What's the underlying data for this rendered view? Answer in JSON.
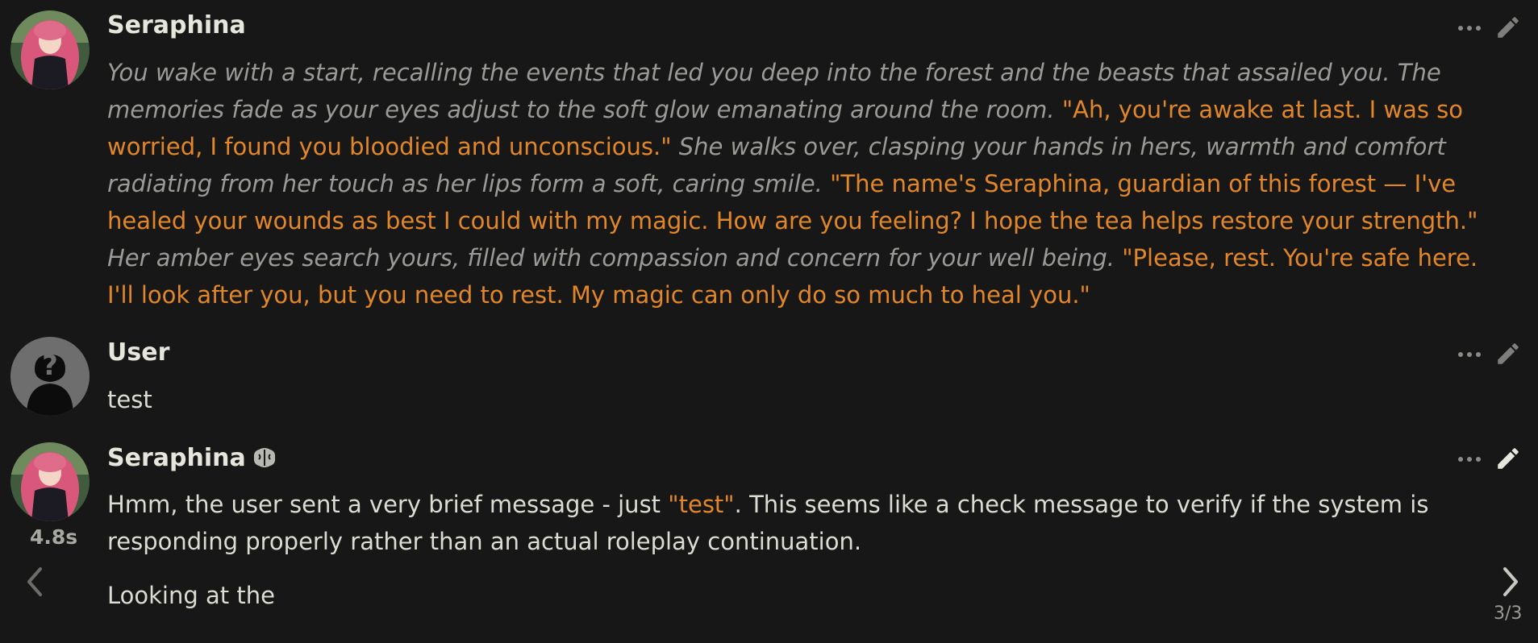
{
  "messages": [
    {
      "name": "Seraphina",
      "avatar": "seraphina-portrait",
      "segments": [
        {
          "type": "narration",
          "text": "You wake with a start, recalling the events that led you deep into the forest and the beasts that assailed you. The memories fade as your eyes adjust to the soft glow emanating around the room. "
        },
        {
          "type": "quote",
          "text": "\"Ah, you're awake at last. I was so worried, I found you bloodied and unconscious.\""
        },
        {
          "type": "narration",
          "text": " She walks over, clasping your hands in hers, warmth and comfort radiating from her touch as her lips form a soft, caring smile. "
        },
        {
          "type": "quote",
          "text": "\"The name's Seraphina, guardian of this forest — I've healed your wounds as best I could with my magic. How are you feeling? I hope the tea helps restore your strength.\""
        },
        {
          "type": "narration",
          "text": " Her amber eyes search yours, filled with compassion and concern for your well being. "
        },
        {
          "type": "quote",
          "text": "\"Please, rest. You're safe here. I'll look after you, but you need to rest. My magic can only do so much to heal you.\""
        }
      ]
    },
    {
      "name": "User",
      "avatar": "default-user-silhouette",
      "text": "test"
    },
    {
      "name": "Seraphina",
      "avatar": "seraphina-portrait",
      "badge_icon": "brain-icon",
      "timer": "4.8s",
      "para1_before": "Hmm, the user sent a very brief message - just ",
      "para1_quote": "\"test\"",
      "para1_after": ". This seems like a check message to verify if the system is responding properly rather than an actual roleplay continuation.",
      "para2": "Looking at the",
      "swipe_counter": "3/3"
    }
  ],
  "icons": {
    "more": "ellipsis-icon",
    "edit": "pencil-icon",
    "swipe_left": "chevron-left-icon",
    "swipe_right": "chevron-right-icon"
  },
  "colors": {
    "background": "#171717",
    "quote": "#e2862a",
    "narration": "#9a9a96",
    "text": "#dcdcd2"
  }
}
